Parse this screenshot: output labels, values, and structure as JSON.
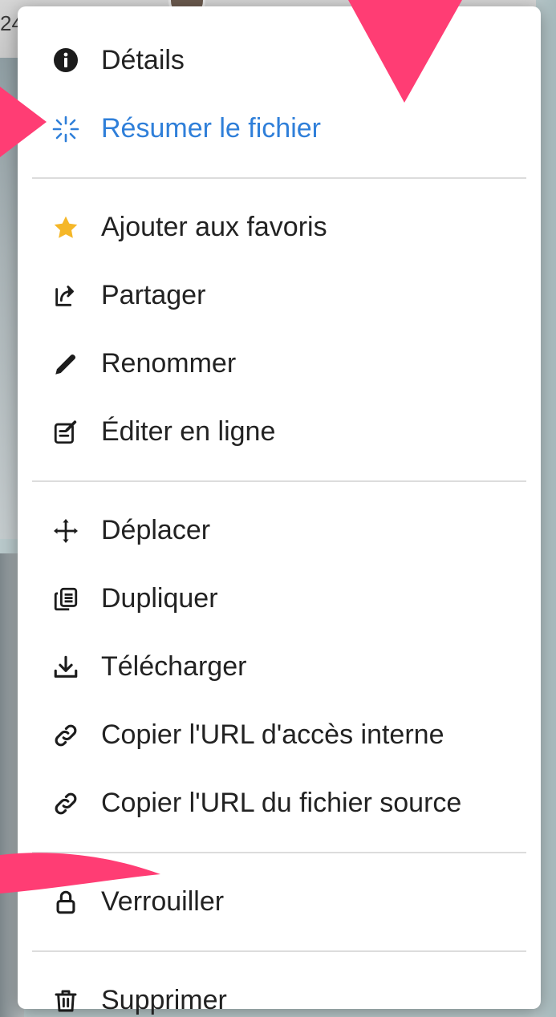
{
  "background": {
    "top_text": "24",
    "accent_pink": "#ff3d74"
  },
  "menu": {
    "groups": [
      [
        {
          "label": "Détails",
          "icon": "info-icon",
          "accent": false
        },
        {
          "label": "Résumer le fichier",
          "icon": "sparkle-icon",
          "accent": true
        }
      ],
      [
        {
          "label": "Ajouter aux favoris",
          "icon": "star-icon",
          "accent": false
        },
        {
          "label": "Partager",
          "icon": "share-icon",
          "accent": false
        },
        {
          "label": "Renommer",
          "icon": "pencil-icon",
          "accent": false
        },
        {
          "label": "Éditer en ligne",
          "icon": "edit-online-icon",
          "accent": false
        }
      ],
      [
        {
          "label": "Déplacer",
          "icon": "move-icon",
          "accent": false
        },
        {
          "label": "Dupliquer",
          "icon": "duplicate-icon",
          "accent": false
        },
        {
          "label": "Télécharger",
          "icon": "download-icon",
          "accent": false
        },
        {
          "label": "Copier l'URL d'accès interne",
          "icon": "link-icon",
          "accent": false
        },
        {
          "label": "Copier l'URL du fichier source",
          "icon": "link-icon",
          "accent": false
        }
      ],
      [
        {
          "label": "Verrouiller",
          "icon": "lock-icon",
          "accent": false
        }
      ],
      [
        {
          "label": "Supprimer",
          "icon": "trash-icon",
          "accent": false
        }
      ]
    ],
    "accent_color": "#2f7fd9",
    "text_color": "#222222"
  }
}
